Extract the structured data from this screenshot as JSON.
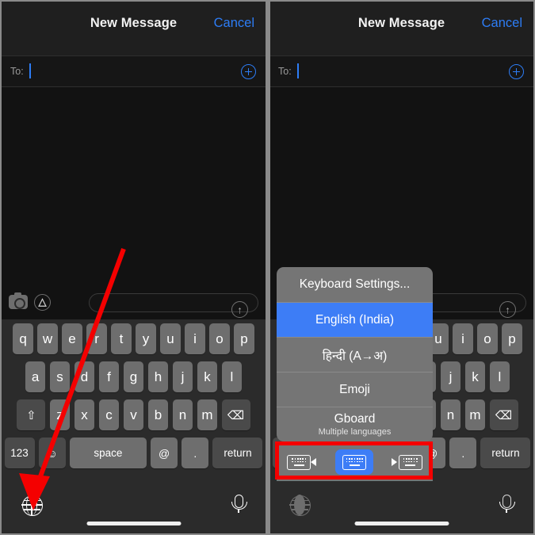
{
  "meta": {
    "app": "Messages",
    "accent_blue": "#2d7df6",
    "highlight_blue": "#3d7df6",
    "annotation_red": "#f40000",
    "key_color": "#6e6e6e",
    "keyboard_bg": "#2b2b2b"
  },
  "navbar": {
    "title": "New Message",
    "cancel_label": "Cancel"
  },
  "to_field": {
    "label": "To:",
    "value": "",
    "add_contact_icon": "plus-circle-icon"
  },
  "compose_bar": {
    "camera_icon": "camera-icon",
    "appstore_icon": "app-store-icon",
    "message_placeholder": "",
    "send_icon": "arrow-up-icon",
    "send_arrow_glyph": "↑"
  },
  "keyboard": {
    "row1": [
      "q",
      "w",
      "e",
      "r",
      "t",
      "y",
      "u",
      "i",
      "o",
      "p"
    ],
    "row2": [
      "a",
      "s",
      "d",
      "f",
      "g",
      "h",
      "j",
      "k",
      "l"
    ],
    "row3_shift": "⇧",
    "row3": [
      "z",
      "x",
      "c",
      "v",
      "b",
      "n",
      "m"
    ],
    "row3_delete": "⌫",
    "row4": {
      "numbers": "123",
      "emoji": "☺",
      "space": "space",
      "at": "@",
      "period": ".",
      "return": "return"
    }
  },
  "bottom_bar": {
    "globe_icon": "globe-icon",
    "mic_icon": "microphone-icon",
    "home_indicator": "home-indicator"
  },
  "language_popup": {
    "items": [
      {
        "label": "Keyboard Settings...",
        "sub": "",
        "selected": false
      },
      {
        "label": "English (India)",
        "sub": "",
        "selected": true
      },
      {
        "label": "हिन्दी (A→अ)",
        "sub": "",
        "selected": false
      },
      {
        "label": "Emoji",
        "sub": "",
        "selected": false
      },
      {
        "label": "Gboard",
        "sub": "Multiple languages",
        "selected": false
      }
    ]
  },
  "layout_switcher": {
    "buttons": [
      {
        "name": "keyboard-dock-left-icon",
        "direction": "left",
        "active": false
      },
      {
        "name": "keyboard-full-icon",
        "direction": "none",
        "active": true
      },
      {
        "name": "keyboard-dock-right-icon",
        "direction": "right",
        "active": false
      }
    ]
  },
  "annotations": {
    "arrow": {
      "name": "red-arrow-annotation",
      "points_to": "globe-icon"
    },
    "rect": {
      "name": "red-rectangle-annotation",
      "highlights": "layout-switcher"
    }
  }
}
